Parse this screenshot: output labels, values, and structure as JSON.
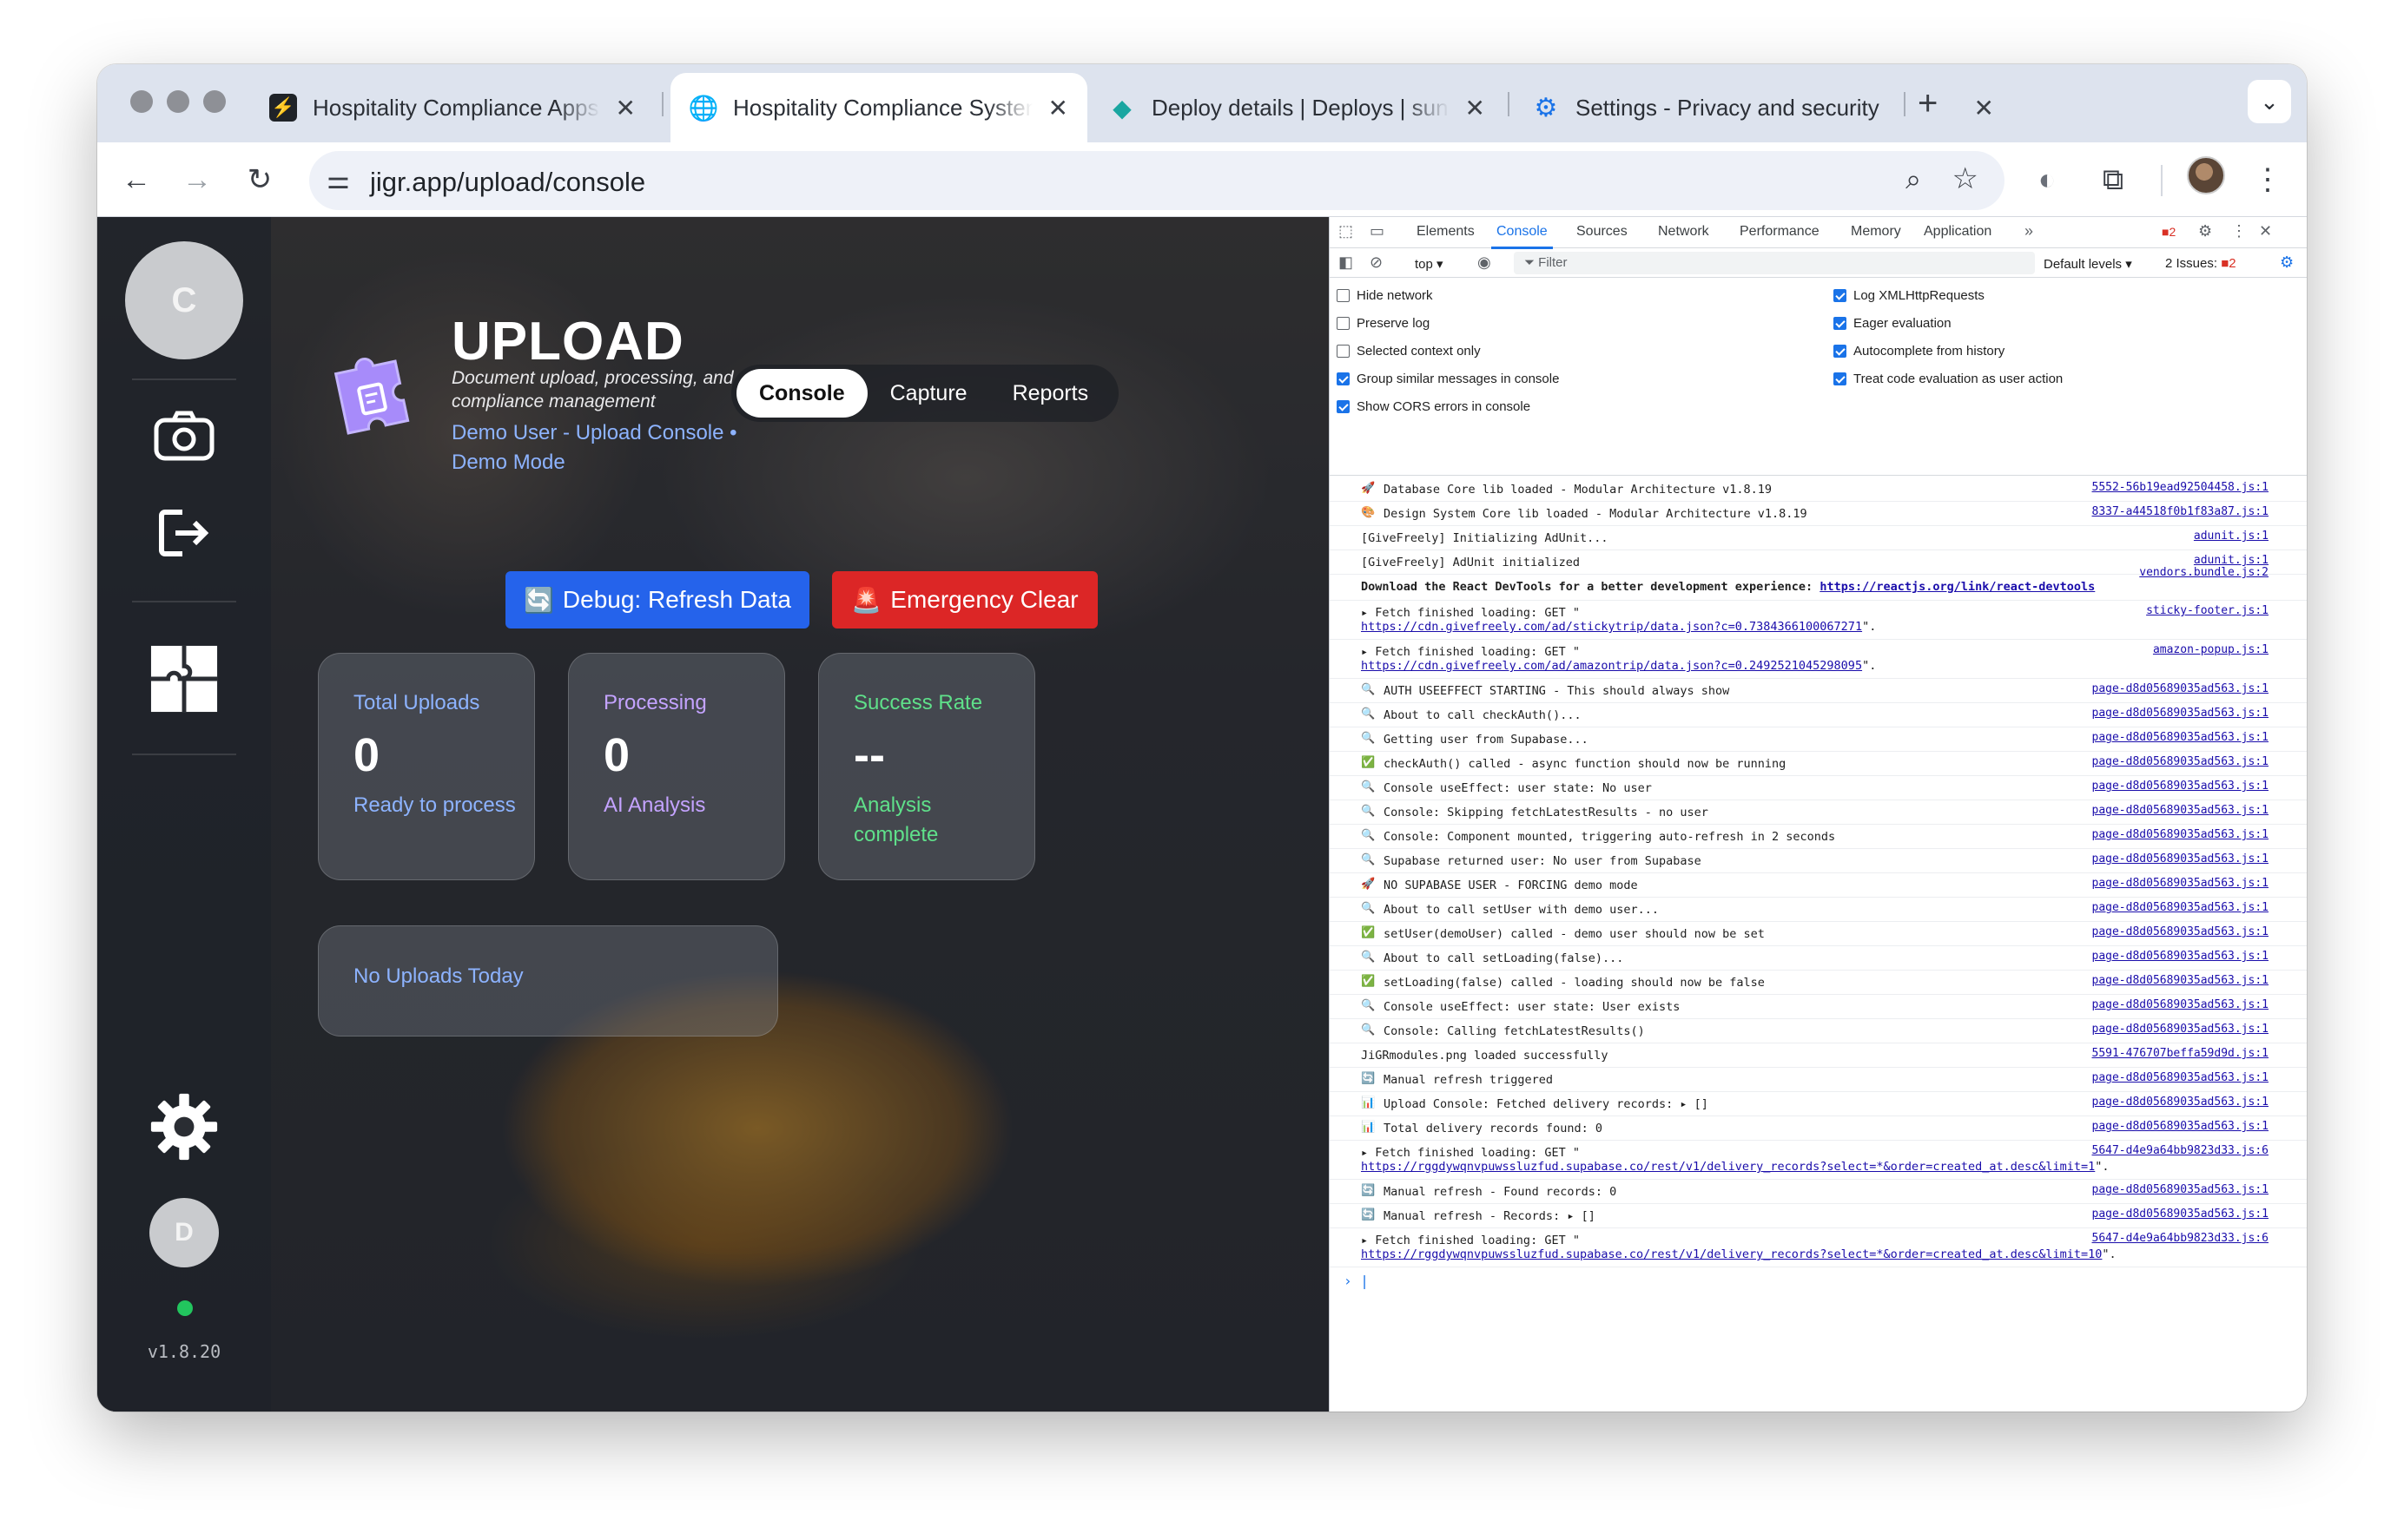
{
  "browser": {
    "tabs": [
      {
        "title": "Hospitality Compliance Apps",
        "icon": "bolt-icon"
      },
      {
        "title": "Hospitality Compliance System",
        "icon": "globe-icon"
      },
      {
        "title": "Deploy details | Deploys | sunny",
        "icon": "netlify-icon"
      },
      {
        "title": "Settings - Privacy and security",
        "icon": "gear-icon"
      }
    ],
    "new_tab": "+",
    "url": "jigr.app/upload/console"
  },
  "app": {
    "sidebar": {
      "avatar_initial": "C",
      "user_initial": "D",
      "version": "v1.8.20",
      "status_color": "#22c55e"
    },
    "title": "UPLOAD",
    "subtitle": "Document upload, processing, and\ncompliance management",
    "demo_text": "Demo User - Upload Console • Demo Mode",
    "nav": [
      "Console",
      "Capture",
      "Reports"
    ],
    "debug_button": "Debug: Refresh Data",
    "emergency_button": "Emergency Clear",
    "cards": [
      {
        "label": "Total Uploads",
        "value": "0",
        "sub": "Ready to process",
        "color": "#8db3ff"
      },
      {
        "label": "Processing",
        "value": "0",
        "sub": "AI Analysis",
        "color": "#c4a3ff"
      },
      {
        "label": "Success Rate",
        "value": "--",
        "sub": "Analysis complete",
        "color": "#5fe08a"
      }
    ],
    "no_uploads": "No Uploads Today"
  },
  "devtools": {
    "tabs": [
      "Elements",
      "Console",
      "Sources",
      "Network",
      "Performance",
      "Memory",
      "Application"
    ],
    "error_count": "2",
    "context": "top ▾",
    "filter_placeholder": "Filter",
    "levels": "Default levels ▾",
    "issues": "2 Issues:",
    "issues_count": "2",
    "settings_left": [
      {
        "label": "Hide network",
        "checked": false
      },
      {
        "label": "Preserve log",
        "checked": false
      },
      {
        "label": "Selected context only",
        "checked": false
      },
      {
        "label": "Group similar messages in console",
        "checked": true
      },
      {
        "label": "Show CORS errors in console",
        "checked": true
      }
    ],
    "settings_right": [
      {
        "label": "Log XMLHttpRequests",
        "checked": true
      },
      {
        "label": "Eager evaluation",
        "checked": true
      },
      {
        "label": "Autocomplete from history",
        "checked": true
      },
      {
        "label": "Treat code evaluation as user action",
        "checked": true
      }
    ],
    "logs": [
      {
        "emoji": "🚀",
        "text": "Database Core lib loaded - Modular Architecture v1.8.19",
        "src": "5552-56b19ead92504458.js:1"
      },
      {
        "emoji": "🎨",
        "text": "Design System Core lib loaded - Modular Architecture v1.8.19",
        "src": "8337-a44518f0b1f83a87.js:1"
      },
      {
        "emoji": "",
        "text": "[GiveFreely] Initializing AdUnit...",
        "src": "adunit.js:1"
      },
      {
        "emoji": "",
        "text": "[GiveFreely] AdUnit initialized",
        "src": "adunit.js:1"
      },
      {
        "emoji": "",
        "text": "Download the React DevTools for a better development experience:",
        "link": "https://reactjs.org/link/react-devtools",
        "src": "vendors.bundle.js:2",
        "bold": true
      },
      {
        "emoji": "",
        "text": "▸ Fetch finished loading: GET \"",
        "link": "https://cdn.givefreely.com/ad/stickytrip/data.json?c=0.7384366100067271",
        "tail": "\".",
        "src": "sticky-footer.js:1"
      },
      {
        "emoji": "",
        "text": "▸ Fetch finished loading: GET \"",
        "link": "https://cdn.givefreely.com/ad/amazontrip/data.json?c=0.2492521045298095",
        "tail": "\".",
        "src": "amazon-popup.js:1"
      },
      {
        "emoji": "🔍",
        "text": "AUTH USEEFFECT STARTING - This should always show",
        "src": "page-d8d05689035ad563.js:1"
      },
      {
        "emoji": "🔍",
        "text": "About to call checkAuth()...",
        "src": "page-d8d05689035ad563.js:1"
      },
      {
        "emoji": "🔍",
        "text": "Getting user from Supabase...",
        "src": "page-d8d05689035ad563.js:1"
      },
      {
        "emoji": "✅",
        "text": "checkAuth() called - async function should now be running",
        "src": "page-d8d05689035ad563.js:1"
      },
      {
        "emoji": "🔍",
        "text": "Console useEffect: user state: No user",
        "src": "page-d8d05689035ad563.js:1"
      },
      {
        "emoji": "🔍",
        "text": "Console: Skipping fetchLatestResults - no user",
        "src": "page-d8d05689035ad563.js:1"
      },
      {
        "emoji": "🔍",
        "text": "Console: Component mounted, triggering auto-refresh in 2 seconds",
        "src": "page-d8d05689035ad563.js:1"
      },
      {
        "emoji": "🔍",
        "text": "Supabase returned user: No user from Supabase",
        "src": "page-d8d05689035ad563.js:1"
      },
      {
        "emoji": "🚀",
        "text": "NO SUPABASE USER - FORCING demo mode",
        "src": "page-d8d05689035ad563.js:1"
      },
      {
        "emoji": "🔍",
        "text": "About to call setUser with demo user...",
        "src": "page-d8d05689035ad563.js:1"
      },
      {
        "emoji": "✅",
        "text": "setUser(demoUser) called - demo user should now be set",
        "src": "page-d8d05689035ad563.js:1"
      },
      {
        "emoji": "🔍",
        "text": "About to call setLoading(false)...",
        "src": "page-d8d05689035ad563.js:1"
      },
      {
        "emoji": "✅",
        "text": "setLoading(false) called - loading should now be false",
        "src": "page-d8d05689035ad563.js:1"
      },
      {
        "emoji": "🔍",
        "text": "Console useEffect: user state: User exists",
        "src": "page-d8d05689035ad563.js:1"
      },
      {
        "emoji": "🔍",
        "text": "Console: Calling fetchLatestResults()",
        "src": "page-d8d05689035ad563.js:1"
      },
      {
        "emoji": "",
        "text": "JiGRmodules.png loaded successfully",
        "src": "5591-476707beffa59d9d.js:1"
      },
      {
        "emoji": "🔄",
        "text": "Manual refresh triggered",
        "src": "page-d8d05689035ad563.js:1"
      },
      {
        "emoji": "📊",
        "text": "Upload Console: Fetched delivery records:  ▸ []",
        "src": "page-d8d05689035ad563.js:1"
      },
      {
        "emoji": "📊",
        "text": "Total delivery records found: 0",
        "src": "page-d8d05689035ad563.js:1"
      },
      {
        "emoji": "",
        "text": "▸ Fetch finished loading: GET \"",
        "link": "https://rggdywqnvpuwssluzfud.supabase.co/rest/v1/delivery_records?select=*&order=created_at.desc&limit=1",
        "tail": "\".",
        "src": "5647-d4e9a64bb9823d33.js:6"
      },
      {
        "emoji": "🔄",
        "text": "Manual refresh - Found records: 0",
        "src": "page-d8d05689035ad563.js:1"
      },
      {
        "emoji": "🔄",
        "text": "Manual refresh - Records:  ▸ []",
        "src": "page-d8d05689035ad563.js:1"
      },
      {
        "emoji": "",
        "text": "▸ Fetch finished loading: GET \"",
        "link": "https://rggdywqnvpuwssluzfud.supabase.co/rest/v1/delivery_records?select=*&order=created_at.desc&limit=10",
        "tail": "\".",
        "src": "5647-d4e9a64bb9823d33.js:6"
      }
    ]
  }
}
